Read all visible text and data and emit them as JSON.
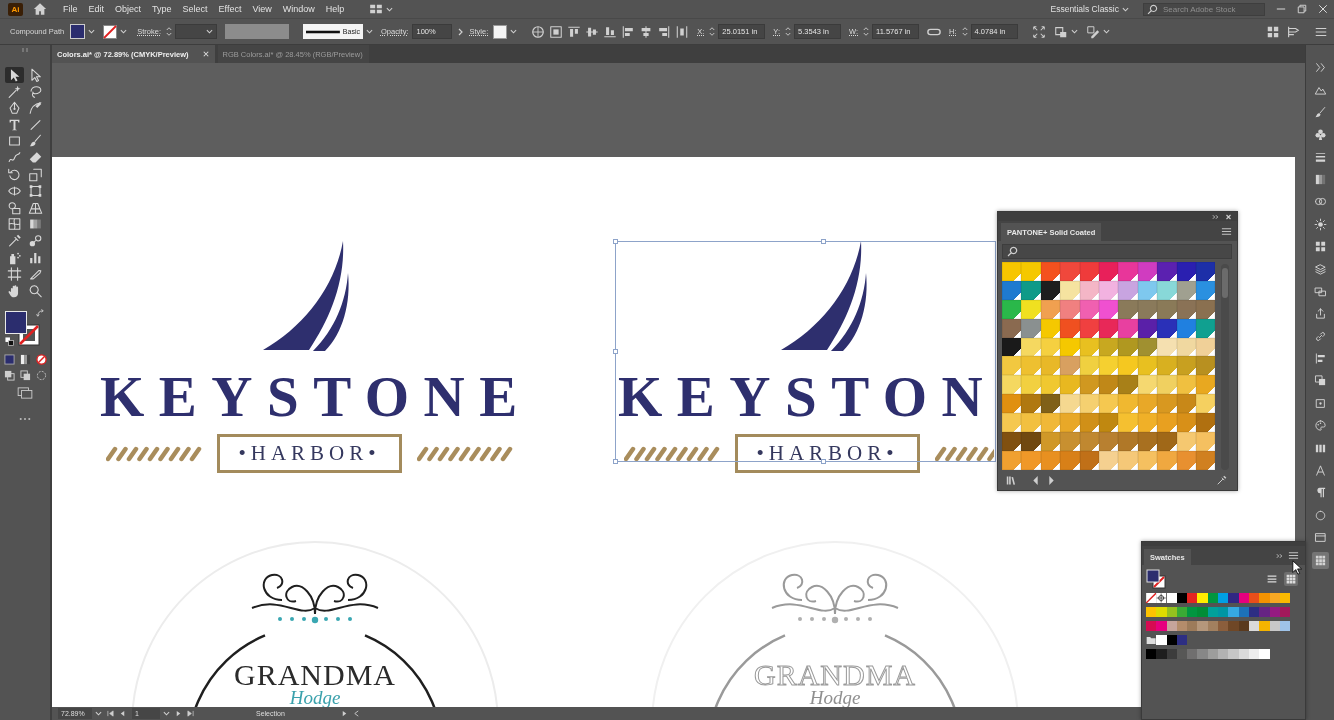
{
  "app_logo": "Ai",
  "menu": [
    "File",
    "Edit",
    "Object",
    "Type",
    "Select",
    "Effect",
    "View",
    "Window",
    "Help"
  ],
  "workspace": "Essentials Classic",
  "stock_search": {
    "placeholder": "Search Adobe Stock"
  },
  "control_bar": {
    "selection_type": "Compound Path",
    "stroke_label": "Stroke:",
    "stroke_profile": "Basic",
    "opacity_label": "Opacity:",
    "opacity": "100%",
    "style_label": "Style:",
    "transform": [
      {
        "label": "X:",
        "value": "25.0151 in"
      },
      {
        "label": "Y:",
        "value": "5.3543 in"
      },
      {
        "label": "W:",
        "value": "11.5767 in"
      },
      {
        "label": "H:",
        "value": "4.0784 in"
      }
    ]
  },
  "tabs": [
    {
      "label": "Colors.ai* @ 72.89% (CMYK/Preview)",
      "selected": true
    },
    {
      "label": "RGB Colors.ai* @ 28.45% (RGB/Preview)",
      "selected": false
    }
  ],
  "tools": [
    {
      "selected": true
    },
    {
      "selected": false
    },
    {
      "selected": false
    },
    {
      "selected": false
    },
    {
      "selected": false
    },
    {
      "selected": false
    },
    {
      "selected": false
    },
    {
      "selected": false
    },
    {
      "selected": false
    },
    {
      "selected": false
    },
    {
      "selected": false
    },
    {
      "selected": false
    },
    {
      "selected": false
    },
    {
      "selected": false
    },
    {
      "selected": false
    },
    {
      "selected": false
    },
    {
      "selected": false
    },
    {
      "selected": false
    },
    {
      "selected": false
    },
    {
      "selected": false
    },
    {
      "selected": false
    },
    {
      "selected": false
    },
    {
      "selected": false
    },
    {
      "selected": false
    },
    {
      "selected": false
    },
    {
      "selected": false
    },
    {
      "selected": false
    },
    {
      "selected": false
    }
  ],
  "dock": [
    {
      "selected": false
    },
    {
      "selected": false
    },
    {
      "selected": false
    },
    {
      "selected": false
    },
    {
      "selected": false
    },
    {
      "selected": false
    },
    {
      "selected": false
    },
    {
      "selected": false
    },
    {
      "selected": false
    },
    {
      "selected": false
    },
    {
      "selected": false
    },
    {
      "selected": false
    },
    {
      "selected": false
    },
    {
      "selected": false
    },
    {
      "selected": false
    },
    {
      "selected": false
    },
    {
      "selected": false
    },
    {
      "selected": false
    },
    {
      "selected": false
    },
    {
      "selected": false
    },
    {
      "selected": false
    },
    {
      "selected": false
    },
    {
      "selected": true
    }
  ],
  "artboard": {
    "logos": [
      {
        "title": "KEYSTONE",
        "subtitle": "•HARBOR•",
        "selected": false
      },
      {
        "title": "KEYSTON",
        "subtitle": "•HARBOR•",
        "selected": true
      }
    ],
    "emblems": [
      {
        "title": "GRANDMA",
        "script": "Hodge",
        "kind": "color"
      },
      {
        "title": "GRANDMA",
        "script": "Hodge",
        "kind": "outline"
      }
    ]
  },
  "pantone_panel": {
    "title": "PANTONE+ Solid Coated",
    "swatches": [
      {
        "color": "#f7c600"
      },
      {
        "color": "#f5c800"
      },
      {
        "color": "#f4511e"
      },
      {
        "color": "#f0483c"
      },
      {
        "color": "#ef3b3b"
      },
      {
        "color": "#e8205a"
      },
      {
        "color": "#e8369a"
      },
      {
        "color": "#d03cc0"
      },
      {
        "color": "#5b21b0"
      },
      {
        "color": "#2a1fb0"
      },
      {
        "color": "#1d2fa8"
      },
      {
        "color": "#1e7ad0"
      },
      {
        "color": "#0f9a88"
      },
      {
        "color": "#1e1e1e"
      },
      {
        "color": "#f5e3a0"
      },
      {
        "color": "#f4b6c6"
      },
      {
        "color": "#f2b2e0"
      },
      {
        "color": "#c8a4e0"
      },
      {
        "color": "#7ec8ee"
      },
      {
        "color": "#88d8d8"
      },
      {
        "color": "#a0a090"
      },
      {
        "color": "#2a90e0"
      },
      {
        "color": "#2ab84a"
      },
      {
        "color": "#f0e020"
      },
      {
        "color": "#f0a050"
      },
      {
        "color": "#f08080"
      },
      {
        "color": "#f060b0"
      },
      {
        "color": "#f050d0"
      },
      {
        "color": "#8a7a5a"
      },
      {
        "color": "#8a7a5b"
      },
      {
        "color": "#8a7a58"
      },
      {
        "color": "#8a7256"
      },
      {
        "color": "#8a7050"
      },
      {
        "color": "#8a6a50"
      },
      {
        "color": "#8a9090"
      },
      {
        "color": "#f5c800"
      },
      {
        "color": "#f05020"
      },
      {
        "color": "#f04040"
      },
      {
        "color": "#e82858"
      },
      {
        "color": "#e840a0"
      },
      {
        "color": "#5a20a8"
      },
      {
        "color": "#2a30b8"
      },
      {
        "color": "#2080e0"
      },
      {
        "color": "#10a090"
      },
      {
        "color": "#1a1a1a"
      },
      {
        "color": "#f5d860"
      },
      {
        "color": "#f5d040"
      },
      {
        "color": "#f5c800"
      },
      {
        "color": "#e8c020"
      },
      {
        "color": "#c8a820"
      },
      {
        "color": "#b09820"
      },
      {
        "color": "#a09030"
      },
      {
        "color": "#f5e0b0"
      },
      {
        "color": "#f0d8a0"
      },
      {
        "color": "#f0d098"
      },
      {
        "color": "#f2c840"
      },
      {
        "color": "#eec030"
      },
      {
        "color": "#e8b828"
      },
      {
        "color": "#d8a060"
      },
      {
        "color": "#f0d040"
      },
      {
        "color": "#f5d030"
      },
      {
        "color": "#f5c820"
      },
      {
        "color": "#e8c020"
      },
      {
        "color": "#d8b020"
      },
      {
        "color": "#c8a020"
      },
      {
        "color": "#b89020"
      },
      {
        "color": "#f5d860"
      },
      {
        "color": "#f2d040"
      },
      {
        "color": "#f0c830"
      },
      {
        "color": "#e8b820"
      },
      {
        "color": "#d09820"
      },
      {
        "color": "#c08818"
      },
      {
        "color": "#a88018"
      },
      {
        "color": "#f5d870"
      },
      {
        "color": "#f0d060"
      },
      {
        "color": "#f0c040"
      },
      {
        "color": "#e8a820"
      },
      {
        "color": "#e09010"
      },
      {
        "color": "#b07810"
      },
      {
        "color": "#806018"
      },
      {
        "color": "#f5d890"
      },
      {
        "color": "#f5d070"
      },
      {
        "color": "#f5c850"
      },
      {
        "color": "#f0b830"
      },
      {
        "color": "#e8a828"
      },
      {
        "color": "#d89820"
      },
      {
        "color": "#c88818"
      },
      {
        "color": "#f5d060"
      },
      {
        "color": "#f5c850"
      },
      {
        "color": "#f2c040"
      },
      {
        "color": "#f0b838"
      },
      {
        "color": "#e8a828"
      },
      {
        "color": "#d09018"
      },
      {
        "color": "#c08810"
      },
      {
        "color": "#f5c030"
      },
      {
        "color": "#f0b028"
      },
      {
        "color": "#e8a020"
      },
      {
        "color": "#d89018"
      },
      {
        "color": "#b07010"
      },
      {
        "color": "#805010"
      },
      {
        "color": "#704810"
      },
      {
        "color": "#d09828"
      },
      {
        "color": "#c89030"
      },
      {
        "color": "#c08830"
      },
      {
        "color": "#b88030"
      },
      {
        "color": "#b07828"
      },
      {
        "color": "#a87020"
      },
      {
        "color": "#a06818"
      },
      {
        "color": "#f5c870"
      },
      {
        "color": "#f5c060"
      },
      {
        "color": "#f0a030"
      },
      {
        "color": "#f09828"
      },
      {
        "color": "#e89020"
      },
      {
        "color": "#d88018"
      },
      {
        "color": "#c07018"
      },
      {
        "color": "#f5d090"
      },
      {
        "color": "#f5c878"
      },
      {
        "color": "#f5c060"
      },
      {
        "color": "#f0a840"
      },
      {
        "color": "#e89030"
      },
      {
        "color": "#d08020"
      }
    ]
  },
  "swatches_panel": {
    "title": "Swatches",
    "views": [
      {
        "selected": false
      },
      {
        "selected": true
      }
    ],
    "rows": [
      [
        {
          "kind": "none"
        },
        {
          "kind": "registration"
        },
        {
          "kind": "color",
          "color": "#ffffff"
        },
        {
          "kind": "color",
          "color": "#000000"
        },
        {
          "kind": "color",
          "color": "#e52421"
        },
        {
          "kind": "color",
          "color": "#ffed00"
        },
        {
          "kind": "color",
          "color": "#00963f"
        },
        {
          "kind": "color",
          "color": "#009fe3"
        },
        {
          "kind": "color",
          "color": "#312783"
        },
        {
          "kind": "color",
          "color": "#e6007e"
        },
        {
          "kind": "color",
          "color": "#e94e1b"
        },
        {
          "kind": "color",
          "color": "#f39200"
        },
        {
          "kind": "color",
          "color": "#f7a823"
        },
        {
          "kind": "color",
          "color": "#fbba00"
        }
      ],
      [
        {
          "kind": "color",
          "color": "#fdc300"
        },
        {
          "kind": "color",
          "color": "#dedc00"
        },
        {
          "kind": "color",
          "color": "#95c11f"
        },
        {
          "kind": "color",
          "color": "#3aaa35"
        },
        {
          "kind": "color",
          "color": "#009640"
        },
        {
          "kind": "color",
          "color": "#008d36"
        },
        {
          "kind": "color",
          "color": "#00a19a"
        },
        {
          "kind": "color",
          "color": "#0096a4"
        },
        {
          "kind": "color",
          "color": "#36a9e1"
        },
        {
          "kind": "color",
          "color": "#1d71b8"
        },
        {
          "kind": "color",
          "color": "#2d2e83"
        },
        {
          "kind": "color",
          "color": "#662483"
        },
        {
          "kind": "color",
          "color": "#951b81"
        },
        {
          "kind": "color",
          "color": "#a3195b"
        }
      ],
      [
        {
          "kind": "color",
          "color": "#d60b52"
        },
        {
          "kind": "color",
          "color": "#e6007e"
        },
        {
          "kind": "color",
          "color": "#c6a49b"
        },
        {
          "kind": "color",
          "color": "#b48c6b"
        },
        {
          "kind": "color",
          "color": "#9d7b5a"
        },
        {
          "kind": "color",
          "color": "#b5977b"
        },
        {
          "kind": "color",
          "color": "#a2805f"
        },
        {
          "kind": "color",
          "color": "#8b5e3c"
        },
        {
          "kind": "color",
          "color": "#6f4726"
        },
        {
          "kind": "color",
          "color": "#5a3a1e"
        },
        {
          "kind": "color",
          "color": "#dadada"
        },
        {
          "kind": "color",
          "color": "#f5b400"
        },
        {
          "kind": "color",
          "color": "#c8c8c8"
        },
        {
          "kind": "color",
          "color": "#9fc3e8"
        }
      ],
      [
        {
          "kind": "folder"
        },
        {
          "kind": "color",
          "color": "#ffffff"
        },
        {
          "kind": "color",
          "color": "#000000"
        },
        {
          "kind": "color",
          "color": "#2d2e83"
        }
      ],
      [
        {
          "kind": "color",
          "color": "#000000"
        },
        {
          "kind": "color",
          "color": "#1e1e1e"
        },
        {
          "kind": "color",
          "color": "#3c3c3c"
        },
        {
          "kind": "color",
          "color": "#575756"
        },
        {
          "kind": "color",
          "color": "#706f6f"
        },
        {
          "kind": "color",
          "color": "#878787"
        },
        {
          "kind": "color",
          "color": "#9d9d9c"
        },
        {
          "kind": "color",
          "color": "#b2b2b2"
        },
        {
          "kind": "color",
          "color": "#c6c6c6"
        },
        {
          "kind": "color",
          "color": "#dadada"
        },
        {
          "kind": "color",
          "color": "#ededed"
        },
        {
          "kind": "color",
          "color": "#ffffff"
        }
      ]
    ]
  },
  "status_bar": {
    "zoom": "72.89%",
    "artboard": "1",
    "tool": "Selection"
  }
}
